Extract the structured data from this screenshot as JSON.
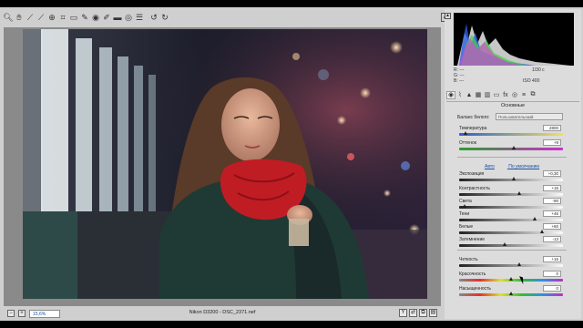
{
  "toolbar": {
    "tools": [
      "zoom-icon",
      "hand-icon",
      "white-balance-icon",
      "color-sampler-icon",
      "target-adjust-icon",
      "crop-icon",
      "straighten-icon",
      "spot-removal-icon",
      "red-eye-icon",
      "adjustment-brush-icon",
      "graduated-filter-icon",
      "radial-filter-icon",
      "preferences-icon",
      "rotate-left-icon",
      "rotate-right-icon"
    ]
  },
  "status": {
    "zoom": "15,6%",
    "filename": "Nikon D3200 - DSC_2371.nef"
  },
  "info": {
    "r": "R:",
    "g": "G:",
    "b": "B:",
    "dash": "---",
    "shutter": "1/30 с",
    "iso": "ISO 400"
  },
  "panel": {
    "section_title": "Основные",
    "wb_label": "Баланс белого:",
    "wb_value": "Пользовательский",
    "auto_link": "Авто",
    "default_link": "По умолчанию"
  },
  "sliders": [
    {
      "label": "Температура",
      "value": "2800",
      "pos": 0.06,
      "track": "linear-gradient(90deg,#2d5fd0,#f0e060)"
    },
    {
      "label": "Оттенок",
      "value": "+9",
      "pos": 0.53,
      "track": "linear-gradient(90deg,#2ca02c,#d02cd0)"
    },
    {
      "label": "Экспозиция",
      "value": "+0,30",
      "pos": 0.53,
      "track": "linear-gradient(90deg,#222,#fafafa)"
    },
    {
      "label": "Контрастность",
      "value": "+16",
      "pos": 0.58,
      "track": "linear-gradient(90deg,#222,#fafafa)"
    },
    {
      "label": "Света",
      "value": "-90",
      "pos": 0.05,
      "track": "linear-gradient(90deg,#222,#fafafa)"
    },
    {
      "label": "Тени",
      "value": "+46",
      "pos": 0.73,
      "track": "linear-gradient(90deg,#222,#fafafa)"
    },
    {
      "label": "Белые",
      "value": "+60",
      "pos": 0.8,
      "track": "linear-gradient(90deg,#222,#fafafa)"
    },
    {
      "label": "Затемнение",
      "value": "-13",
      "pos": 0.44,
      "track": "linear-gradient(90deg,#222,#fafafa)"
    },
    {
      "label": "Четкость",
      "value": "+15",
      "pos": 0.58,
      "track": "linear-gradient(90deg,#222,#fafafa)"
    },
    {
      "label": "Красочность",
      "value": "0",
      "pos": 0.5,
      "track": "linear-gradient(90deg,#888,#e03030,#e0e030,#30c030,#3090e0,#c030c0)"
    },
    {
      "label": "Насыщенность",
      "value": "0",
      "pos": 0.5,
      "track": "linear-gradient(90deg,#888,#e03030,#e0e030,#30c030,#3090e0,#c030c0)"
    }
  ],
  "colors": {
    "panel_bg": "#dcdcdc",
    "link": "#1a4fa0"
  }
}
